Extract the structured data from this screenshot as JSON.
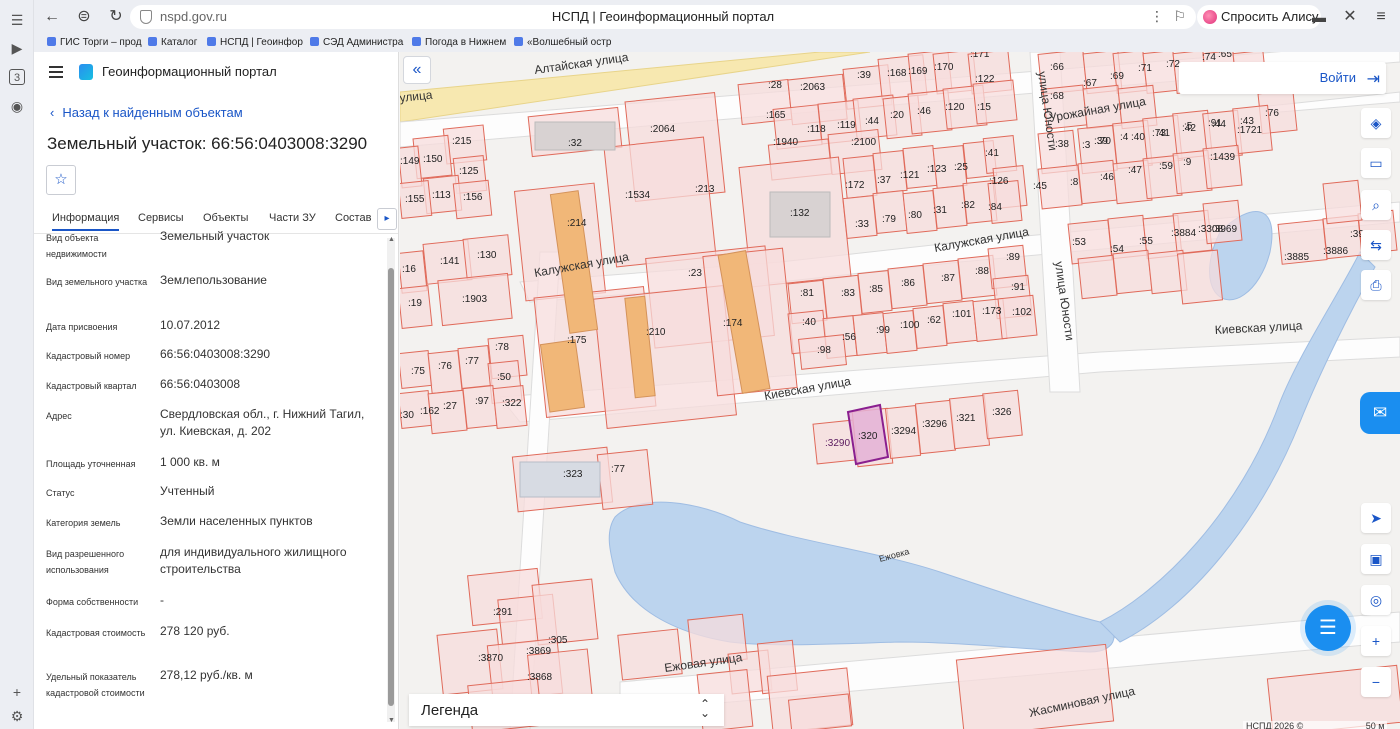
{
  "browser": {
    "url": "nspd.gov.ru",
    "page_title": "НСПД | Геоинформационный портал",
    "alisa": "Спросить Алису AI",
    "bookmarks": [
      "ГИС Торги – прод",
      "Каталог",
      "НСПД | Геоинфор",
      "СЭД Администра",
      "Погода в Нижнем",
      "«Волшебный остр"
    ]
  },
  "panel": {
    "portal_title": "Геоинформационный портал",
    "back_link": "Назад к найденным объектам",
    "object_title": "Земельный участок: 66:56:0403008:3290",
    "tabs": [
      "Информация",
      "Сервисы",
      "Объекты",
      "Части ЗУ",
      "Состав"
    ],
    "properties": [
      {
        "label": "Вид объекта недвижимости",
        "value": "Земельный участок"
      },
      {
        "label": "Вид земельного участка",
        "value": "Землепользование"
      },
      {
        "label": "Дата присвоения",
        "value": "10.07.2012"
      },
      {
        "label": "Кадастровый номер",
        "value": "66:56:0403008:3290"
      },
      {
        "label": "Кадастровый квартал",
        "value": "66:56:0403008"
      },
      {
        "label": "Адрес",
        "value": "Свердловская обл., г. Нижний Тагил, ул. Киевская, д. 202"
      },
      {
        "label": "Площадь уточненная",
        "value": "1 000 кв. м"
      },
      {
        "label": "Статус",
        "value": "Учтенный"
      },
      {
        "label": "Категория земель",
        "value": "Земли населенных пунктов"
      },
      {
        "label": "Вид разрешенного использования",
        "value": "для индивидуального жилищного строительства"
      },
      {
        "label": "Форма собственности",
        "value": "-"
      },
      {
        "label": "Кадастровая стоимость",
        "value": "278 120 руб."
      },
      {
        "label": "Удельный показатель кадастровой стоимости",
        "value": "278,12 руб./кв. м"
      }
    ]
  },
  "map": {
    "login": "Войти",
    "legend": "Легенда",
    "footer": "НСПД 2026 ©",
    "scale": "50 м",
    "streets": [
      "Алтайская улица",
      "улица",
      "Калужская улица",
      "Калужская улица",
      "Киевская улица",
      "Киевская улица",
      "Урожайная улица",
      "улица Юности",
      "улица Юности",
      "Ежовая улица",
      "Жасминовая улица",
      "Ежовка"
    ],
    "highlighted_parcel": ":3290",
    "parcel_labels": [
      ":28",
      ":2063",
      ":39",
      ":168",
      ":169",
      ":170",
      ":171",
      ":122",
      ":165",
      ":118",
      ":119",
      ":44",
      ":20",
      ":46",
      ":120",
      ":15",
      ":1940",
      ":2100",
      ":32",
      ":2064",
      ":215",
      ":150",
      ":149",
      ":125",
      ":113",
      ":156",
      ":155",
      ":1534",
      ":213",
      ":214",
      ":132",
      ":172",
      ":37",
      ":121",
      ":123",
      ":25",
      ":41",
      ":126",
      ":33",
      ":79",
      ":80",
      ":31",
      ":82",
      ":84",
      ":141",
      ":130",
      ":16",
      ":19",
      ":1903",
      ":23",
      ":175",
      ":210",
      ":174",
      ":81",
      ":83",
      ":85",
      ":86",
      ":87",
      ":88",
      ":89",
      ":91",
      ":40",
      ":56",
      ":99",
      ":100",
      ":62",
      ":101",
      ":173",
      ":102",
      ":98",
      ":78",
      ":75",
      ":76",
      ":77",
      ":50",
      ":30",
      ":162",
      ":27",
      ":97",
      ":322",
      ":3290",
      ":320",
      ":3294",
      ":3296",
      ":321",
      ":326",
      ":323",
      ":77",
      ":66",
      ":67",
      ":69",
      ":71",
      ":72",
      ":74",
      ":65",
      ":76",
      ":68",
      ":3",
      ":70",
      ":4",
      ":73",
      ":5",
      ":91",
      ":1721",
      ":38",
      ":39",
      ":40",
      ":41",
      ":42",
      ":44",
      ":43",
      ":45",
      ":8",
      ":46",
      ":47",
      ":59",
      ":9",
      ":1439",
      ":53",
      ":54",
      ":55",
      ":3884",
      ":3308",
      ":3969",
      ":3885",
      ":3886",
      ":303",
      ":3924",
      ":291",
      ":305",
      ":3870",
      ":3869",
      ":3868"
    ]
  }
}
